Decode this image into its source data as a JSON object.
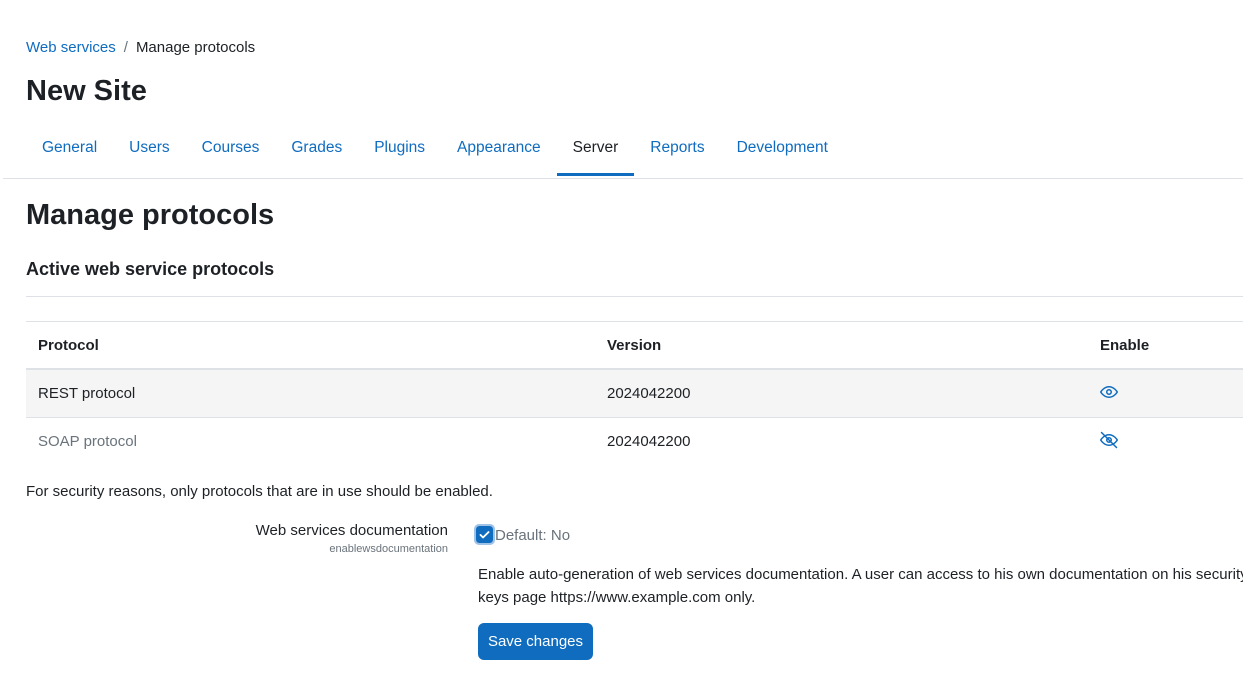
{
  "breadcrumb": {
    "items": [
      {
        "label": "Web services"
      },
      {
        "label": "Manage protocols"
      }
    ],
    "separator": "/"
  },
  "site_title": "New Site",
  "tabs": [
    {
      "label": "General"
    },
    {
      "label": "Users"
    },
    {
      "label": "Courses"
    },
    {
      "label": "Grades"
    },
    {
      "label": "Plugins"
    },
    {
      "label": "Appearance"
    },
    {
      "label": "Server",
      "active": true
    },
    {
      "label": "Reports"
    },
    {
      "label": "Development"
    }
  ],
  "page_heading": "Manage protocols",
  "section_heading": "Active web service protocols",
  "table": {
    "headers": [
      "Protocol",
      "Version",
      "Enable"
    ],
    "rows": [
      {
        "protocol": "REST protocol",
        "version": "2024042200",
        "enabled": true,
        "icon": "eye-icon"
      },
      {
        "protocol": "SOAP protocol",
        "version": "2024042200",
        "enabled": false,
        "icon": "eye-slash-icon"
      }
    ]
  },
  "security_note": "For security reasons, only protocols that are in use should be enabled.",
  "setting": {
    "label": "Web services documentation",
    "name": "enablewsdocumentation",
    "checked": true,
    "default_text": "Default: No",
    "description": "Enable auto-generation of web services documentation. A user can access to his own documentation on his security keys page https://www.example.com only."
  },
  "save_button": "Save changes",
  "colors": {
    "link": "#0f6cbf",
    "primary": "#0f6cbf",
    "text": "#1d2125",
    "muted": "#6a737b",
    "row_shade": "#f5f5f5"
  }
}
